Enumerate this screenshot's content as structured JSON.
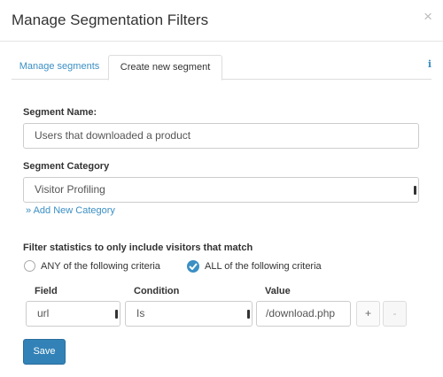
{
  "modal": {
    "title": "Manage Segmentation Filters",
    "close_glyph": "×"
  },
  "tabs": [
    {
      "label": "Manage segments",
      "active": false
    },
    {
      "label": "Create new segment",
      "active": true
    }
  ],
  "info_glyph": "i",
  "form": {
    "segment_name_label": "Segment Name:",
    "segment_name_value": "Users that downloaded a product",
    "segment_category_label": "Segment Category",
    "segment_category_value": "Visitor Profiling",
    "add_category_link": "» Add New Category",
    "filter_heading": "Filter statistics to only include visitors that match",
    "match_options": [
      {
        "label": "ANY of the following criteria",
        "selected": false
      },
      {
        "label": "ALL of the following criteria",
        "selected": true
      }
    ],
    "columns": {
      "field": "Field",
      "condition": "Condition",
      "value": "Value"
    },
    "criteria_row": {
      "field": "url",
      "condition": "Is",
      "value": "/download.php"
    },
    "add_glyph": "+",
    "remove_glyph": "-",
    "save_label": "Save"
  },
  "colors": {
    "accent": "#3b8fc4",
    "save_button": "#3282b7"
  },
  "icons": {
    "close": "close-icon",
    "info": "info-icon",
    "radio_checked": "checkmark-icon"
  }
}
